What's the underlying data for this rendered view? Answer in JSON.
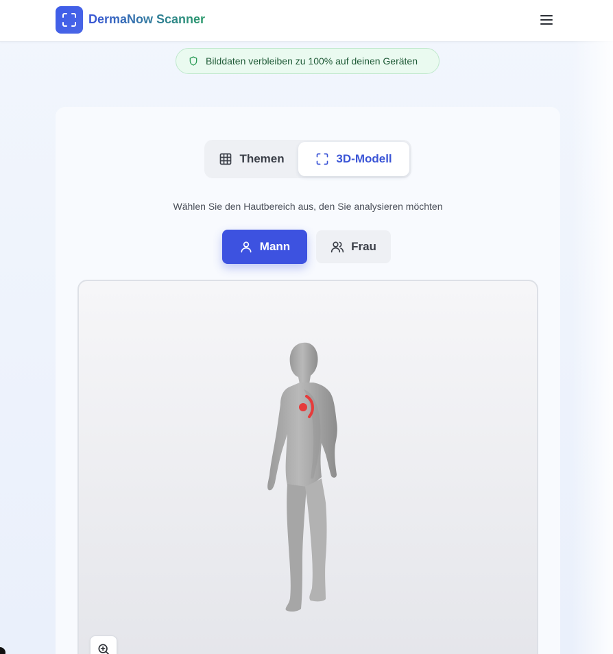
{
  "header": {
    "brand": "DermaNow Scanner",
    "logo_icon": "scan-frame-icon",
    "menu_icon": "hamburger-menu-icon"
  },
  "privacy_notice": {
    "icon": "shield-icon",
    "text": "Bilddaten verbleiben zu 100% auf deinen Geräten"
  },
  "view_tabs": [
    {
      "label": "Themen",
      "icon": "grid-icon",
      "active": false
    },
    {
      "label": "3D-Modell",
      "icon": "scan-frame-icon",
      "active": true
    }
  ],
  "instruction": "Wählen Sie den Hautbereich aus, den Sie analysieren möchten",
  "gender_options": [
    {
      "label": "Mann",
      "icon": "user-icon",
      "selected": true
    },
    {
      "label": "Frau",
      "icon": "users-icon",
      "selected": false
    }
  ],
  "viewer": {
    "zoom_icon": "zoom-in-icon"
  },
  "colors": {
    "primary": "#3d52e0",
    "brand_gradient_start": "#3a56d8",
    "brand_gradient_end": "#2a9a6a",
    "marker": "#e63b3b",
    "privacy_bg": "#eafaf0"
  }
}
